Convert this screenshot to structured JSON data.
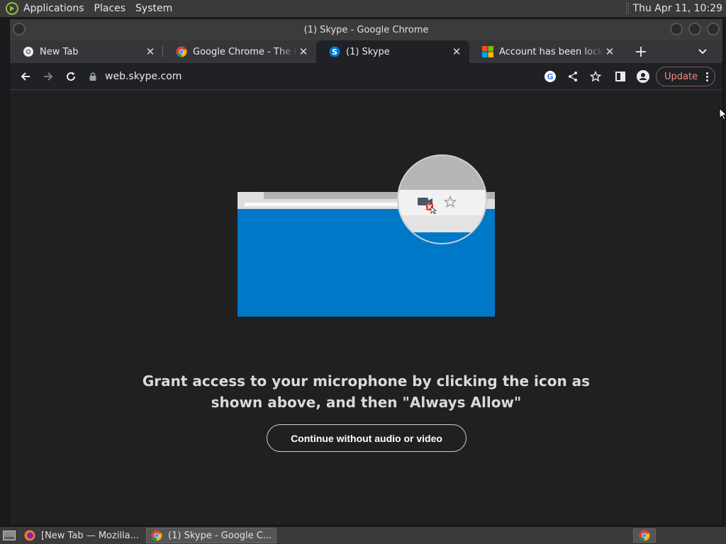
{
  "top_panel": {
    "menus": [
      "Applications",
      "Places",
      "System"
    ],
    "clock": "Thu Apr 11, 10:29"
  },
  "window": {
    "title": "(1) Skype - Google Chrome"
  },
  "tabs": [
    {
      "title": "New Tab",
      "icon": "chrome-newtab-icon",
      "active": false
    },
    {
      "title": "Google Chrome - The Fast",
      "icon": "chrome-icon",
      "active": false
    },
    {
      "title": "(1) Skype",
      "icon": "skype-icon",
      "active": true
    },
    {
      "title": "Account has been locked",
      "icon": "microsoft-icon",
      "active": false
    }
  ],
  "toolbar": {
    "url": "web.skype.com",
    "update_label": "Update"
  },
  "content": {
    "message_line1": "Grant access to your microphone by clicking the icon as",
    "message_line2": "shown above, and then \"Always Allow\"",
    "cta_label": "Continue without audio or video"
  },
  "taskbar": {
    "tasks": [
      {
        "label": "[New Tab — Mozilla...",
        "icon": "firefox-icon",
        "active": false
      },
      {
        "label": "(1) Skype - Google C...",
        "icon": "chrome-icon",
        "active": true
      }
    ]
  },
  "colors": {
    "skype_blue": "#0078c8",
    "update_red": "#f28b82",
    "page_bg": "#202020"
  }
}
